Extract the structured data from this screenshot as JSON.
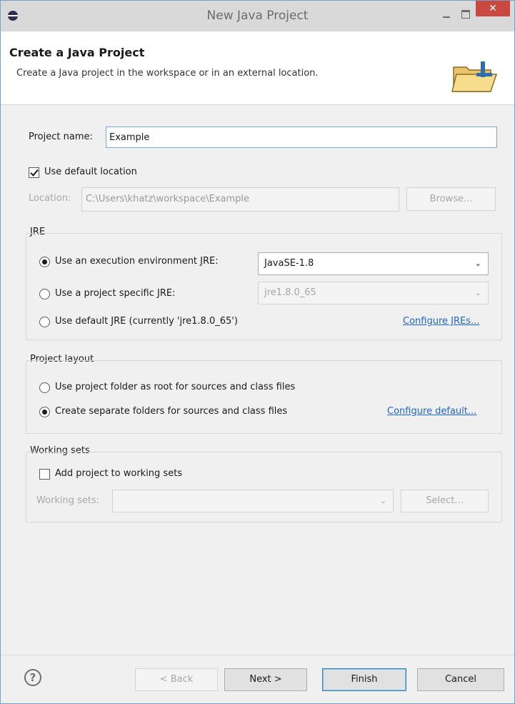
{
  "window": {
    "title": "New Java Project",
    "close_glyph": "✕"
  },
  "banner": {
    "title": "Create a Java Project",
    "description": "Create a Java project in the workspace or in an external location.",
    "icon": "folder-icon"
  },
  "project": {
    "name_label": "Project name:",
    "name_value": "Example",
    "use_default_location_label": "Use default location",
    "use_default_location_checked": true,
    "location_label": "Location:",
    "location_value": "C:\\Users\\khatz\\workspace\\Example",
    "browse_label": "Browse..."
  },
  "jre": {
    "group_label": "JRE",
    "options": [
      {
        "label": "Use an execution environment JRE:",
        "selected": true
      },
      {
        "label": "Use a project specific JRE:",
        "selected": false
      },
      {
        "label": "Use default JRE (currently 'jre1.8.0_65')",
        "selected": false
      }
    ],
    "execution_environment_value": "JavaSE-1.8",
    "project_specific_value": "jre1.8.0_65",
    "configure_link": "Configure JREs..."
  },
  "layout": {
    "group_label": "Project layout",
    "options": [
      {
        "label": "Use project folder as root for sources and class files",
        "selected": false
      },
      {
        "label": "Create separate folders for sources and class files",
        "selected": true
      }
    ],
    "configure_link": "Configure default..."
  },
  "working_sets": {
    "group_label": "Working sets",
    "add_label": "Add project to working sets",
    "add_checked": false,
    "working_sets_label": "Working sets:",
    "working_sets_value": "",
    "select_label": "Select..."
  },
  "footer": {
    "help_glyph": "?",
    "back_label": "< Back",
    "next_label": "Next >",
    "finish_label": "Finish",
    "cancel_label": "Cancel"
  },
  "glyphs": {
    "dropdown": "⌄"
  },
  "colors": {
    "close_button": "#c9483f",
    "link": "#1e64c8",
    "focus_border": "#7aa7d4"
  }
}
